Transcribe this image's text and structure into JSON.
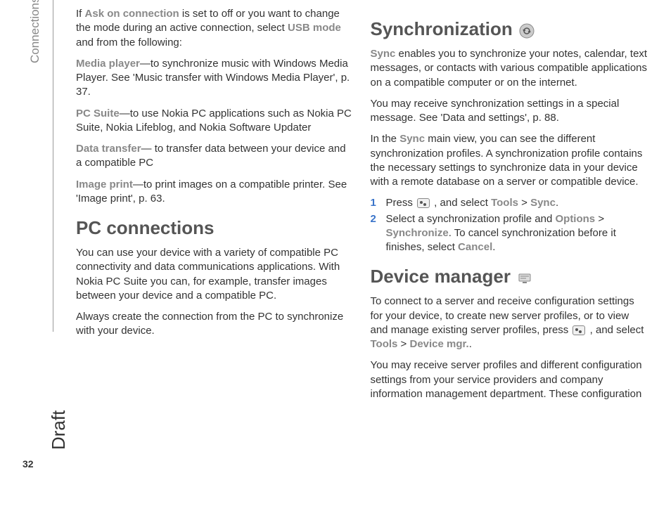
{
  "sideLabel": "Connections",
  "draftLabel": "Draft",
  "pageNumber": "32",
  "left": {
    "p1a": "If ",
    "p1b": "Ask on connection",
    "p1c": " is set to off or you want to change the mode during an active connection, select ",
    "p1d": "USB mode",
    "p1e": " and from the following:",
    "media_k": "Media player",
    "media_t": "—to synchronize music with Windows Media Player. See 'Music transfer with Windows Media Player', p. 37.",
    "pcsuite_k": "PC Suite",
    "pcsuite_t": "—to use Nokia PC applications such as Nokia PC Suite, Nokia Lifeblog, and Nokia Software Updater",
    "datat_k": "Data transfer",
    "datat_t": "— to transfer data between your device and a compatible PC",
    "imgp_k": "Image print",
    "imgp_t": "—to print images on a compatible printer. See 'Image print', p. 63.",
    "h_pc": "PC connections",
    "pc_p1": "You can use your device with a variety of compatible PC connectivity and data communications applications. With Nokia PC Suite you can, for example, transfer images between your device and a compatible PC.",
    "pc_p2": "Always create the connection from the PC to synchronize with your device."
  },
  "right": {
    "h_sync": "Synchronization",
    "sync_k": "Sync",
    "sync_p1": " enables you to synchronize your notes, calendar, text messages, or contacts with various compatible applications on a compatible computer or on the internet.",
    "sync_p2": "You may receive synchronization settings in a special message. See 'Data and settings', p. 88.",
    "sync_p3a": "In the ",
    "sync_p3b": "Sync",
    "sync_p3c": " main view, you can see the different synchronization profiles. A synchronization profile contains the necessary settings to synchronize data in your device with a remote database on a server or compatible device.",
    "li1a": "Press ",
    "li1b": " , and select ",
    "li1c": "Tools",
    "li1d": " > ",
    "li1e": "Sync",
    "li1f": ".",
    "li2a": "Select a synchronization profile and ",
    "li2b": "Options",
    "li2c": " > ",
    "li2d": "Synchronize",
    "li2e": ". To cancel synchronization before it finishes, select ",
    "li2f": "Cancel",
    "li2g": ".",
    "h_dm": "Device manager",
    "dm_p1a": "To connect to a server and receive configuration settings for your device, to create new server profiles, or to view and manage existing server profiles, press ",
    "dm_p1b": " , and select ",
    "dm_p1c": "Tools",
    "dm_p1d": " > ",
    "dm_p1e": "Device mgr.",
    "dm_p1f": ".",
    "dm_p2": "You may receive server profiles and different configuration settings from your service providers and company information management department. These configuration"
  }
}
